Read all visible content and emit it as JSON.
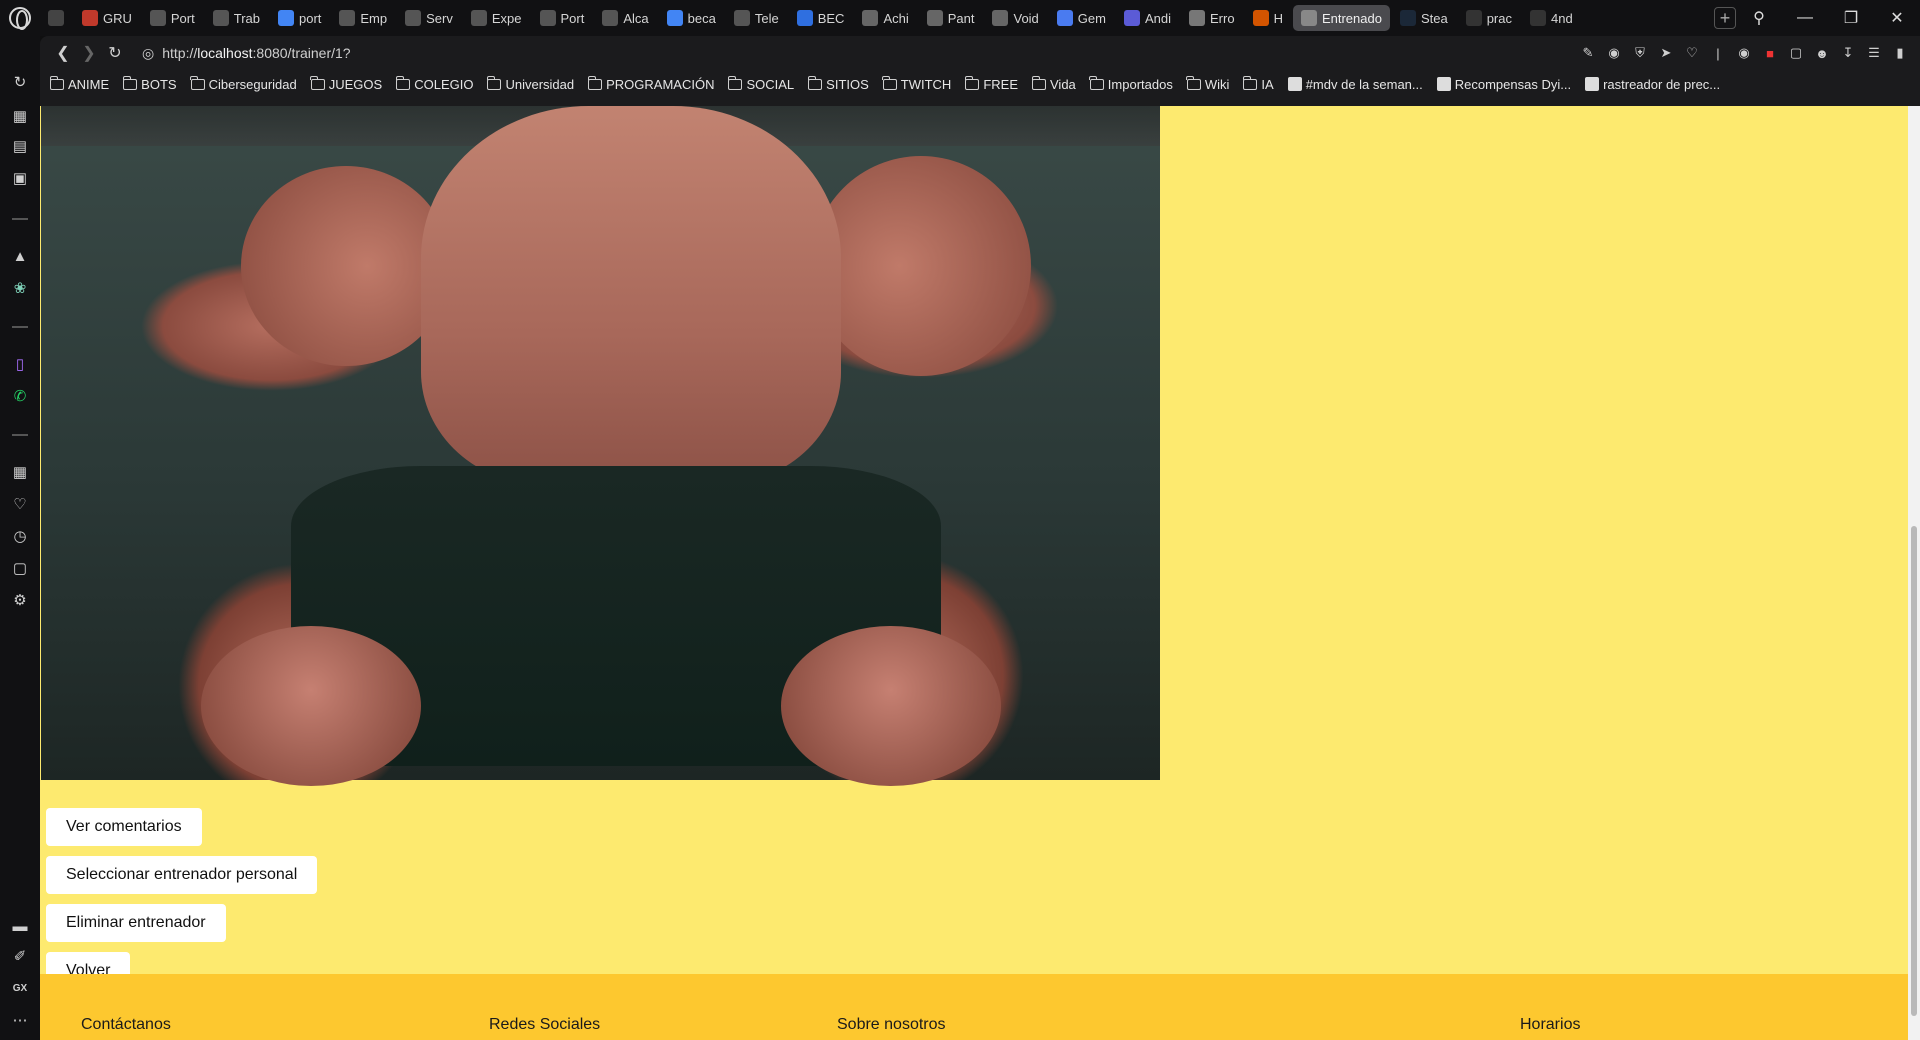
{
  "tabs": [
    {
      "label": "",
      "icon": "image-icon",
      "color": "#444"
    },
    {
      "label": "GRU",
      "icon": "chart-icon",
      "color": "#c0392b"
    },
    {
      "label": "Port",
      "icon": "document-icon",
      "color": "#555"
    },
    {
      "label": "Trab",
      "icon": "document-icon",
      "color": "#555"
    },
    {
      "label": "port",
      "icon": "google-icon",
      "color": "#4285f4"
    },
    {
      "label": "Emp",
      "icon": "document-icon",
      "color": "#555"
    },
    {
      "label": "Serv",
      "icon": "document-icon",
      "color": "#555"
    },
    {
      "label": "Expe",
      "icon": "document-icon",
      "color": "#555"
    },
    {
      "label": "Port",
      "icon": "document-icon",
      "color": "#555"
    },
    {
      "label": "Alca",
      "icon": "document-icon",
      "color": "#555"
    },
    {
      "label": "beca",
      "icon": "google-icon",
      "color": "#4285f4"
    },
    {
      "label": "Tele",
      "icon": "document-icon",
      "color": "#555"
    },
    {
      "label": "BEC",
      "icon": "app-icon",
      "color": "#2f6fe0"
    },
    {
      "label": "Achi",
      "icon": "skull-icon",
      "color": "#666"
    },
    {
      "label": "Pant",
      "icon": "skull-icon",
      "color": "#666"
    },
    {
      "label": "Void",
      "icon": "skull-icon",
      "color": "#666"
    },
    {
      "label": "Gem",
      "icon": "sparkle-icon",
      "color": "#4a7bf0"
    },
    {
      "label": "Andi",
      "icon": "app-icon",
      "color": "#5b5bd6"
    },
    {
      "label": "Erro",
      "icon": "openai-icon",
      "color": "#777"
    },
    {
      "label": "H",
      "icon": "burst-icon",
      "color": "#d35400"
    },
    {
      "label": "Entrenado",
      "icon": "globe-icon",
      "color": "#888"
    },
    {
      "label": "Stea",
      "icon": "steam-icon",
      "color": "#1b2838"
    },
    {
      "label": "prac",
      "icon": "github-icon",
      "color": "#333"
    },
    {
      "label": "4nd",
      "icon": "github-icon",
      "color": "#333"
    }
  ],
  "active_tab_label": "Entrenado",
  "address_bar": {
    "url_prefix": "http://",
    "url_host": "localhost",
    "url_rest": ":8080/trainer/1?"
  },
  "bookmarks": [
    {
      "label": "ANIME",
      "type": "folder"
    },
    {
      "label": "BOTS",
      "type": "folder"
    },
    {
      "label": "Ciberseguridad",
      "type": "folder"
    },
    {
      "label": "JUEGOS",
      "type": "folder"
    },
    {
      "label": "COLEGIO",
      "type": "folder"
    },
    {
      "label": "Universidad",
      "type": "folder"
    },
    {
      "label": "PROGRAMACIÓN",
      "type": "folder"
    },
    {
      "label": "SOCIAL",
      "type": "folder"
    },
    {
      "label": "SITIOS",
      "type": "folder"
    },
    {
      "label": "TWITCH",
      "type": "folder"
    },
    {
      "label": "FREE",
      "type": "folder"
    },
    {
      "label": "Vida",
      "type": "folder"
    },
    {
      "label": "Importados",
      "type": "folder"
    },
    {
      "label": "Wiki",
      "type": "folder"
    },
    {
      "label": "IA",
      "type": "folder"
    },
    {
      "label": "#mdv de la seman...",
      "type": "page"
    },
    {
      "label": "Recompensas Dyi...",
      "type": "page"
    },
    {
      "label": "rastreador de prec...",
      "type": "page"
    }
  ],
  "page": {
    "buttons": {
      "ver_comentarios": "Ver comentarios",
      "seleccionar": "Seleccionar entrenador personal",
      "eliminar": "Eliminar entrenador",
      "volver": "Volver"
    },
    "footer": {
      "contactanos": "Contáctanos",
      "redes": "Redes Sociales",
      "sobre": "Sobre nosotros",
      "horarios": "Horarios"
    },
    "colors": {
      "page_bg": "#fdea6f",
      "footer_bg": "#fdc82f"
    }
  },
  "sidebar": {
    "bottom_label": "GX"
  }
}
